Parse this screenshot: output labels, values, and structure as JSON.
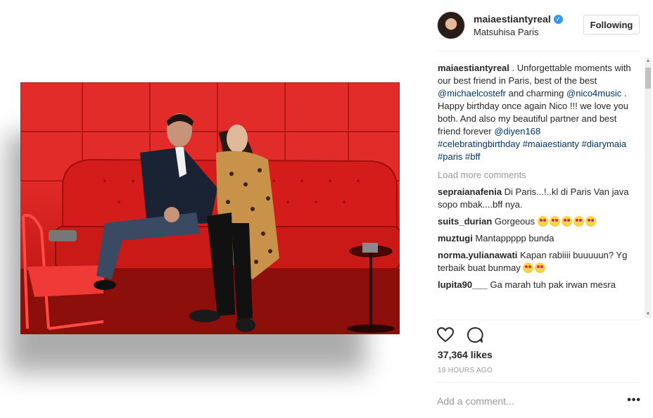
{
  "post": {
    "username": "maiaestiantyreal",
    "location": "Matsuhisa Paris",
    "follow_label": "Following",
    "caption": {
      "user": "maiaestiantyreal",
      "text_1": " . Unforgettable moments with our best friend in Paris, best of the best ",
      "mention_1": "@michaelcostefr",
      "text_2": " and charming ",
      "mention_2": "@nico4music",
      "text_3": " . Happy birthday once again Nico !!! we love you both. And also my beautiful partner and best friend forever ",
      "mention_3": "@diyen168",
      "hashtags": [
        "#celebratingbirthday",
        "#maiaestianty",
        "#diarymaia",
        "#paris",
        "#bff"
      ]
    },
    "load_more": "Load more comments",
    "comments": [
      {
        "user": "sepraianafenia",
        "text": "Di Paris...!..kl di Paris Van java sopo mbak....bff nya.",
        "emojis": 0
      },
      {
        "user": "suits_durian",
        "text": "Gorgeous",
        "emojis": 5
      },
      {
        "user": "muztugi",
        "text": "Mantappppp bunda",
        "emojis": 0
      },
      {
        "user": "norma.yulianawati",
        "text": "Kapan rabiiii buuuuun? Yg terbaik buat bunmay",
        "emojis": 2
      },
      {
        "user": "lupita90___",
        "text": "Ga marah tuh pak irwan mesra",
        "emojis": 0
      }
    ],
    "likes": "37,364 likes",
    "time": "18 HOURS AGO",
    "comment_placeholder": "Add a comment...",
    "more_label": "•••",
    "icons": {
      "like": "heart-icon",
      "comment": "comment-bubble-icon",
      "verified": "verified-badge-icon"
    },
    "colors": {
      "link": "#003569",
      "muted": "#999999",
      "verified": "#3897f0",
      "photo_red": "#e12a27"
    }
  }
}
